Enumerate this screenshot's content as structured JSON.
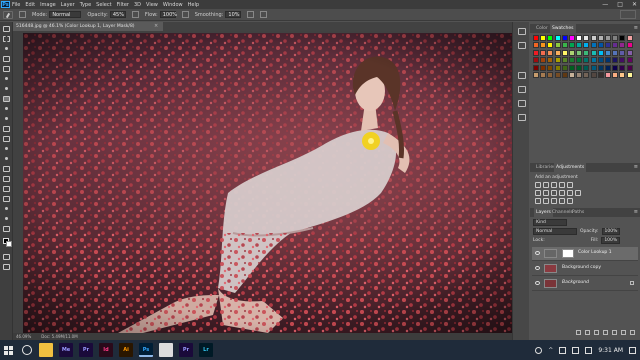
{
  "menubar": {
    "app_badge": "Ps",
    "items": [
      "File",
      "Edit",
      "Image",
      "Layer",
      "Type",
      "Select",
      "Filter",
      "3D",
      "View",
      "Window",
      "Help"
    ],
    "window_controls": [
      "—",
      "□",
      "✕"
    ]
  },
  "options": {
    "mode_label": "Mode:",
    "mode_value": "Normal",
    "opacity_label": "Opacity:",
    "opacity_value": "45%",
    "flow_label": "Flow:",
    "flow_value": "100%",
    "smoothing_label": "Smoothing:",
    "smoothing_value": "10%"
  },
  "document": {
    "tab_title": "516448.jpg @ 46.1% (Color Lookup 1, Layer Mask/8)",
    "zoom": "46.09%",
    "doc_info": "Doc: 5.49M/11.0M"
  },
  "panels": {
    "swatches_tabs": [
      "Color",
      "Swatches"
    ],
    "adjust_tabs": [
      "Libraries",
      "Adjustments"
    ],
    "adjust_hint": "Add an adjustment",
    "layers_tabs": [
      "Layers",
      "Channels",
      "Paths"
    ],
    "kind_label": "Kind",
    "blend_mode": "Normal",
    "opacity_label": "Opacity:",
    "opacity_value": "100%",
    "lock_label": "Lock:",
    "fill_label": "Fill:",
    "fill_value": "100%",
    "layers": [
      {
        "name": "Color Lookup 1",
        "active": true
      },
      {
        "name": "Background copy",
        "active": false
      },
      {
        "name": "Background",
        "active": false
      }
    ]
  },
  "swatch_colors": [
    "#ff0000",
    "#ffff00",
    "#00ff00",
    "#00ffff",
    "#0000ff",
    "#ff00ff",
    "#ffffff",
    "#e6e6e6",
    "#cccccc",
    "#b3b3b3",
    "#999999",
    "#808080",
    "#000000",
    "#f2a2a2",
    "#f26522",
    "#f7941d",
    "#fff200",
    "#8dc63f",
    "#39b54a",
    "#00a651",
    "#00a99d",
    "#00aeef",
    "#0072bc",
    "#0054a6",
    "#2e3192",
    "#662d91",
    "#92278f",
    "#ec008c",
    "#ed1c24",
    "#f26c4f",
    "#f68e56",
    "#fbaf5d",
    "#fff568",
    "#acd373",
    "#7cc576",
    "#3bb878",
    "#1abbb4",
    "#00bff3",
    "#438ccb",
    "#5574b9",
    "#605ca8",
    "#855fa8",
    "#9e0b0f",
    "#a0410d",
    "#a36209",
    "#aba000",
    "#598527",
    "#197b30",
    "#007236",
    "#00746b",
    "#0076a3",
    "#004a80",
    "#003471",
    "#1b1464",
    "#440e62",
    "#630460",
    "#790000",
    "#7b2e00",
    "#7d4900",
    "#827b00",
    "#406618",
    "#005e20",
    "#005826",
    "#005952",
    "#005b7f",
    "#003663",
    "#002157",
    "#0d004c",
    "#32004b",
    "#4b0049",
    "#c69c6d",
    "#a67c52",
    "#8c6239",
    "#754c24",
    "#603913",
    "#c7b299",
    "#998675",
    "#736357",
    "#534741",
    "#362f2d",
    "#f5989d",
    "#f9ad81",
    "#fdc68a",
    "#fff79a"
  ],
  "taskbar": {
    "apps": [
      {
        "name": "file-explorer",
        "label": "",
        "color": "#f0c040",
        "active": false
      },
      {
        "name": "adobe-media-encoder",
        "label": "Me",
        "color": "#1a0a3a",
        "text": "#9999ff",
        "active": false
      },
      {
        "name": "premiere",
        "label": "Pr",
        "color": "#1a0a3a",
        "text": "#9999ff",
        "active": false
      },
      {
        "name": "indesign",
        "label": "Id",
        "color": "#2a0a1a",
        "text": "#ff3a85",
        "active": false
      },
      {
        "name": "illustrator",
        "label": "Ai",
        "color": "#2a1600",
        "text": "#ff9a00",
        "active": false
      },
      {
        "name": "photoshop",
        "label": "Ps",
        "color": "#001e36",
        "text": "#31a8ff",
        "active": true
      },
      {
        "name": "chrome",
        "label": "",
        "color": "#dddddd",
        "active": false
      },
      {
        "name": "premiere-alt",
        "label": "Pr",
        "color": "#1a0a3a",
        "text": "#9999ff",
        "active": false
      },
      {
        "name": "lightroom",
        "label": "Lr",
        "color": "#001a26",
        "text": "#31c5f0",
        "active": false
      }
    ],
    "time": "9:31 AM",
    "tray_icons": [
      "person-icon",
      "chevron-up-icon",
      "network-icon",
      "volume-icon",
      "keyboard-icon"
    ]
  }
}
